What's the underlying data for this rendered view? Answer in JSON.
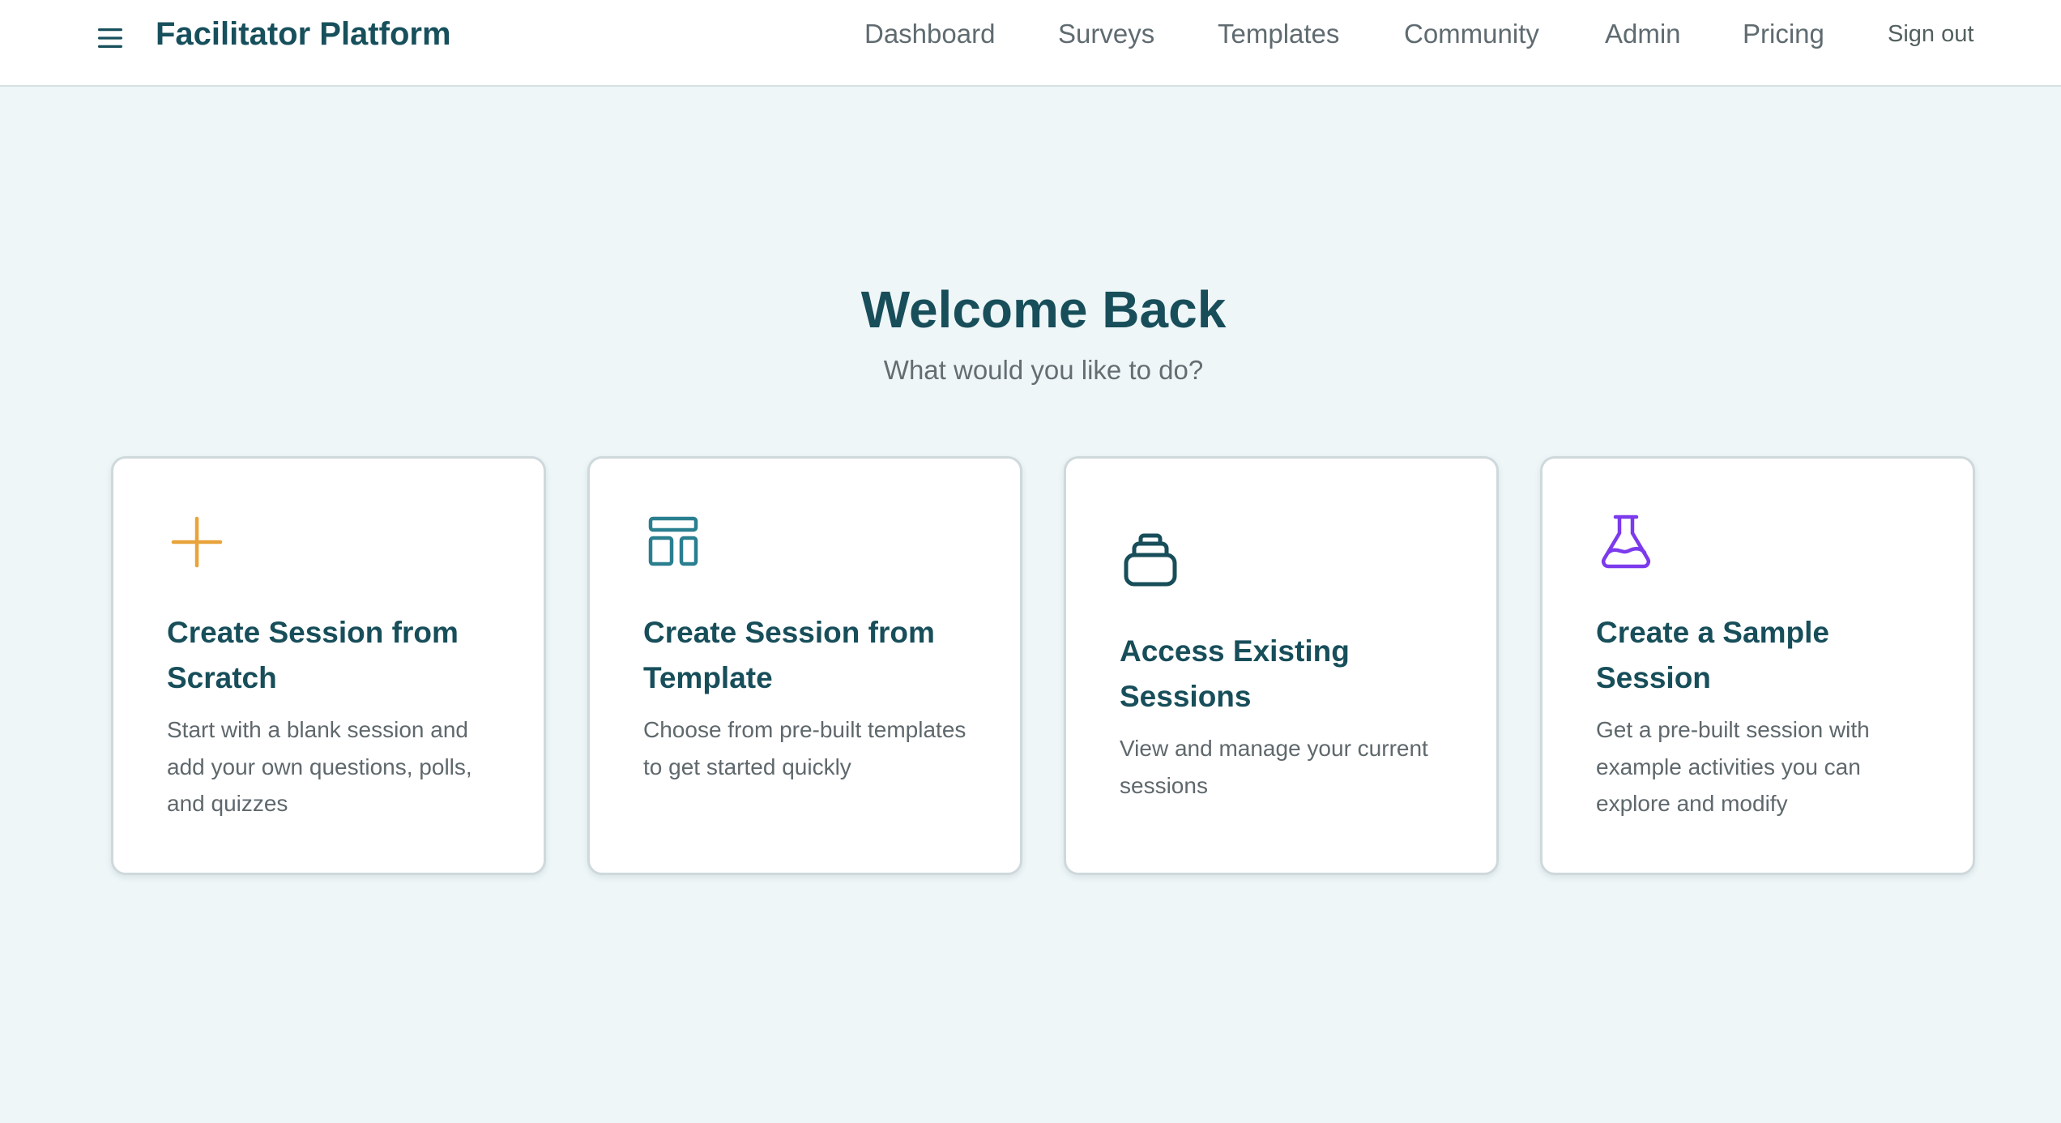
{
  "header": {
    "app_title": "Facilitator Platform",
    "nav": [
      "Dashboard",
      "Surveys",
      "Templates",
      "Community",
      "Admin",
      "Pricing"
    ],
    "sign_out": "Sign out"
  },
  "hero": {
    "title": "Welcome Back",
    "subtitle": "What would you like to do?"
  },
  "cards": [
    {
      "icon": "plus-icon",
      "title": "Create Session from Scratch",
      "description": "Start with a blank session and add your own questions, polls, and quizzes"
    },
    {
      "icon": "template-icon",
      "title": "Create Session from Template",
      "description": "Choose from pre-built templates to get started quickly"
    },
    {
      "icon": "archive-icon",
      "title": "Access Existing Sessions",
      "description": "View and manage your current sessions"
    },
    {
      "icon": "flask-icon",
      "title": "Create a Sample Session",
      "description": "Get a pre-built session with example activities you can explore and modify"
    }
  ],
  "colors": {
    "primary": "#174e5a",
    "plus_icon": "#e8a33b",
    "template_icon": "#2a7f8f",
    "archive_icon": "#174e5a",
    "flask_icon": "#7c3aed",
    "background": "#eef6f8"
  }
}
